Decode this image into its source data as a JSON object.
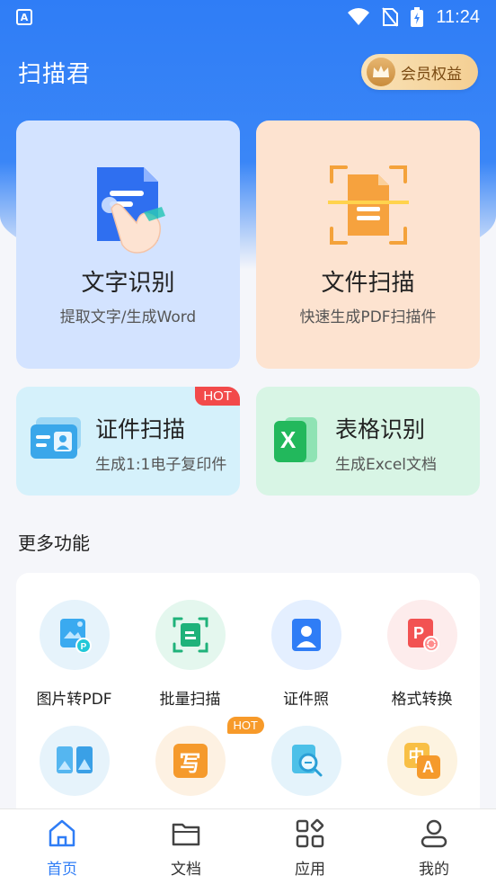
{
  "status_bar": {
    "time": "11:24",
    "app_badge": "A"
  },
  "header": {
    "title": "扫描君",
    "vip_label": "会员权益"
  },
  "cards": {
    "ocr": {
      "title": "文字识别",
      "subtitle": "提取文字/生成Word"
    },
    "file_scan": {
      "title": "文件扫描",
      "subtitle": "快速生成PDF扫描件"
    },
    "id_scan": {
      "title": "证件扫描",
      "subtitle": "生成1:1电子复印件",
      "badge": "HOT"
    },
    "table_ocr": {
      "title": "表格识别",
      "subtitle": "生成Excel文档",
      "icon_letter": "X"
    }
  },
  "more": {
    "title": "更多功能",
    "tools": [
      {
        "label": "图片转PDF",
        "icon": "image-to-pdf-icon"
      },
      {
        "label": "批量扫描",
        "icon": "batch-scan-icon"
      },
      {
        "label": "证件照",
        "icon": "id-photo-icon"
      },
      {
        "label": "格式转换",
        "icon": "format-convert-icon"
      },
      {
        "label": "",
        "icon": "image-split-icon"
      },
      {
        "label": "",
        "icon": "handwriting-icon",
        "badge": "HOT",
        "glyph": "写"
      },
      {
        "label": "",
        "icon": "doc-search-icon"
      },
      {
        "label": "",
        "icon": "translate-icon",
        "glyph_a": "中",
        "glyph_b": "A"
      }
    ]
  },
  "bottom_nav": {
    "items": [
      {
        "label": "首页",
        "icon": "home-icon",
        "active": true
      },
      {
        "label": "文档",
        "icon": "folder-icon"
      },
      {
        "label": "应用",
        "icon": "apps-icon"
      },
      {
        "label": "我的",
        "icon": "profile-icon"
      }
    ]
  },
  "colors": {
    "primary": "#2f7df6",
    "hot_red": "#f24a4a",
    "hot_orange": "#f79a2a",
    "vip_gold": "#f4cf93"
  }
}
